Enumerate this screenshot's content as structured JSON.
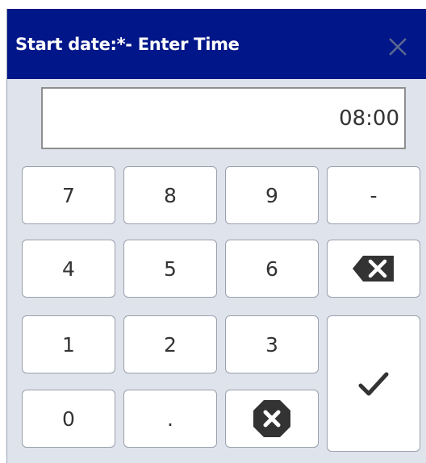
{
  "dialog": {
    "title": "Start date:*- Enter Time",
    "close_icon": "close-icon"
  },
  "display": {
    "value": "08:00"
  },
  "keypad": {
    "k7": "7",
    "k8": "8",
    "k9": "9",
    "minus": "-",
    "k4": "4",
    "k5": "5",
    "k6": "6",
    "k1": "1",
    "k2": "2",
    "k3": "3",
    "k0": "0",
    "dot": ".",
    "backspace_icon": "backspace-icon",
    "clear_icon": "clear-icon",
    "enter_icon": "checkmark-icon"
  },
  "colors": {
    "titlebar": "#001689",
    "dialog_bg": "#dfe3ec",
    "key_bg": "#ffffff"
  }
}
